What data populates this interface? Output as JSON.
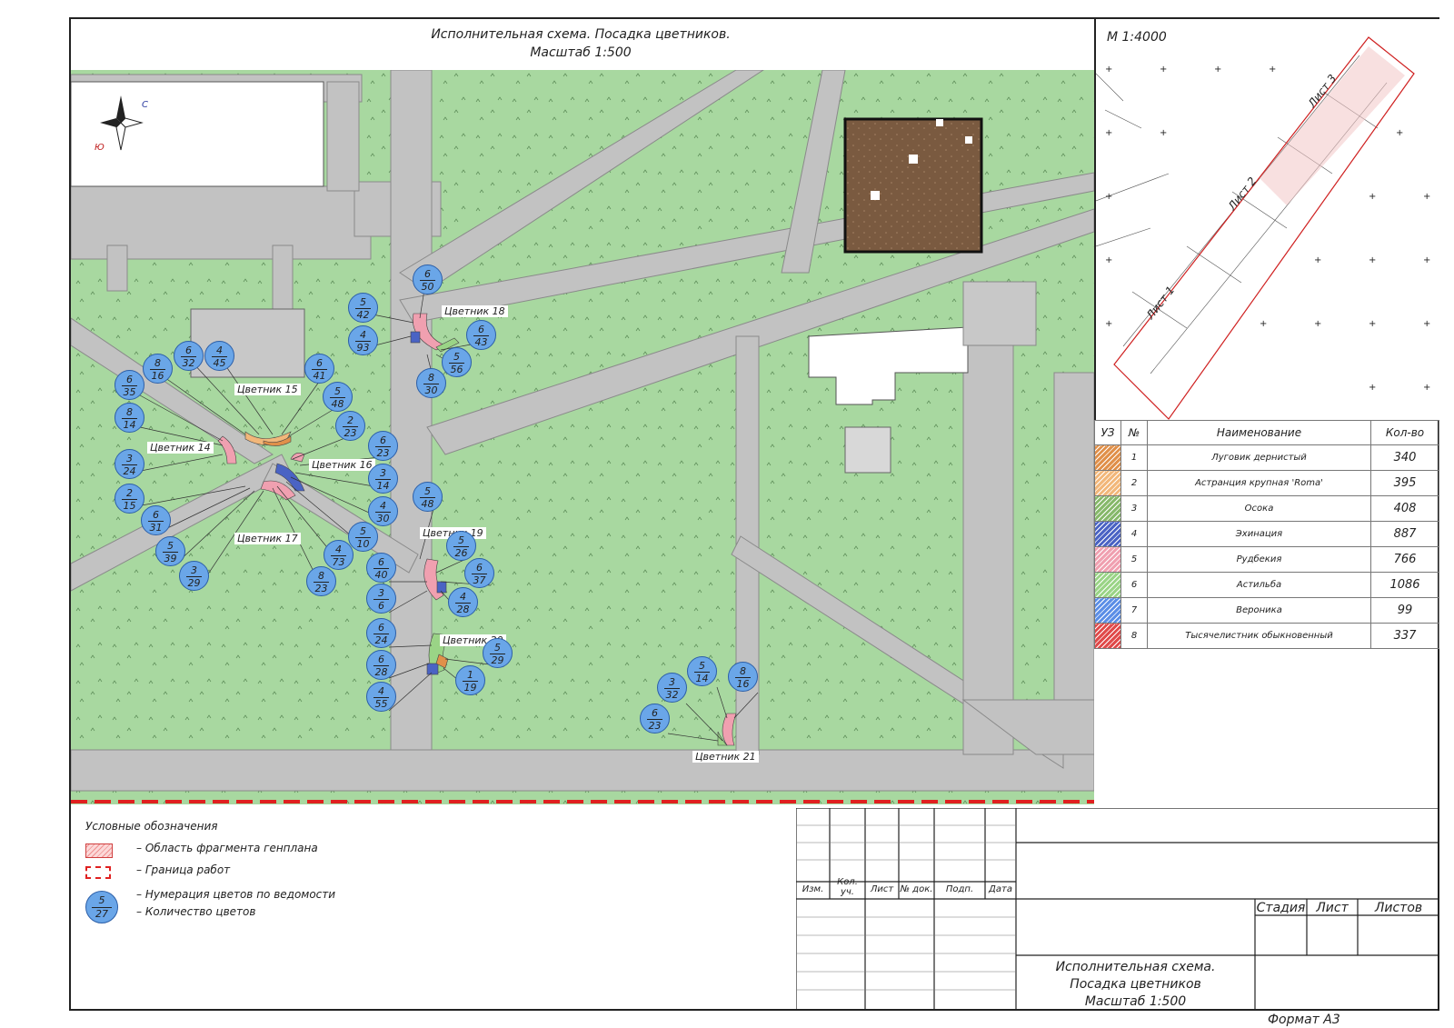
{
  "title": {
    "line1": "Исполнительная схема. Посадка цветников.",
    "line2": "Масштаб 1:500"
  },
  "inset": {
    "scale": "М 1:4000",
    "sheet1": "Лист 1",
    "sheet2": "Лист 2",
    "sheet3": "Лист 3"
  },
  "compass": {
    "north": "С",
    "south": "Ю"
  },
  "plant_table": {
    "headers": [
      "УЗ",
      "№",
      "Наименование",
      "Кол-во"
    ],
    "rows": [
      {
        "num": "1",
        "name": "Луговик дернистый",
        "qty": "340",
        "color": "#e0904a"
      },
      {
        "num": "2",
        "name": "Астранция крупная 'Roma'",
        "qty": "395",
        "color": "#f2b77a"
      },
      {
        "num": "3",
        "name": "Осока",
        "qty": "408",
        "color": "#86b86a"
      },
      {
        "num": "4",
        "name": "Эхинация",
        "qty": "887",
        "color": "#4a63c4"
      },
      {
        "num": "5",
        "name": "Рудбекия",
        "qty": "766",
        "color": "#f0a0b0"
      },
      {
        "num": "6",
        "name": "Астильба",
        "qty": "1086",
        "color": "#9ad486"
      },
      {
        "num": "7",
        "name": "Вероника",
        "qty": "99",
        "color": "#5b8ee6"
      },
      {
        "num": "8",
        "name": "Тысячелистник обыкновенный",
        "qty": "337",
        "color": "#e04a4a"
      }
    ]
  },
  "flowerbeds": [
    "Цветник 18",
    "Цветник 15",
    "Цветник 14",
    "Цветник 16",
    "Цветник 19",
    "Цветник 17",
    "Цветник 20",
    "Цветник 21"
  ],
  "markers": [
    {
      "n": "6",
      "q": "50"
    },
    {
      "n": "5",
      "q": "42"
    },
    {
      "n": "4",
      "q": "93"
    },
    {
      "n": "6",
      "q": "43"
    },
    {
      "n": "5",
      "q": "56"
    },
    {
      "n": "8",
      "q": "30"
    },
    {
      "n": "8",
      "q": "16"
    },
    {
      "n": "6",
      "q": "32"
    },
    {
      "n": "4",
      "q": "45"
    },
    {
      "n": "6",
      "q": "41"
    },
    {
      "n": "5",
      "q": "48"
    },
    {
      "n": "6",
      "q": "35"
    },
    {
      "n": "8",
      "q": "14"
    },
    {
      "n": "3",
      "q": "24"
    },
    {
      "n": "2",
      "q": "15"
    },
    {
      "n": "6",
      "q": "31"
    },
    {
      "n": "5",
      "q": "39"
    },
    {
      "n": "3",
      "q": "29"
    },
    {
      "n": "2",
      "q": "23"
    },
    {
      "n": "6",
      "q": "23"
    },
    {
      "n": "3",
      "q": "14"
    },
    {
      "n": "4",
      "q": "30"
    },
    {
      "n": "5",
      "q": "10"
    },
    {
      "n": "4",
      "q": "73"
    },
    {
      "n": "8",
      "q": "23"
    },
    {
      "n": "5",
      "q": "48"
    },
    {
      "n": "5",
      "q": "26"
    },
    {
      "n": "6",
      "q": "37"
    },
    {
      "n": "6",
      "q": "40"
    },
    {
      "n": "3",
      "q": "6"
    },
    {
      "n": "4",
      "q": "28"
    },
    {
      "n": "6",
      "q": "24"
    },
    {
      "n": "6",
      "q": "28"
    },
    {
      "n": "4",
      "q": "55"
    },
    {
      "n": "5",
      "q": "29"
    },
    {
      "n": "1",
      "q": "19"
    },
    {
      "n": "3",
      "q": "32"
    },
    {
      "n": "5",
      "q": "14"
    },
    {
      "n": "8",
      "q": "16"
    },
    {
      "n": "6",
      "q": "23"
    }
  ],
  "legend": {
    "title": "Условные обозначения",
    "item1": "– Область фрагмента генплана",
    "item2": "– Граница работ",
    "item3": "– Нумерация цветов по ведомости",
    "item4": "– Количество цветов",
    "sample_n": "5",
    "sample_q": "27"
  },
  "stamp": {
    "izm": "Изм.",
    "kol": "Кол. уч.",
    "list": "Лист",
    "ndok": "№ док.",
    "podp": "Подп.",
    "data": "Дата",
    "stadia": "Стадия",
    "list2": "Лист",
    "listov": "Листов",
    "name1": "Исполнительная схема.",
    "name2": "Посадка цветников",
    "name3": "Масштаб 1:500",
    "format": "Формат А3"
  },
  "colors": {
    "grass": "#a8d8a0",
    "road": "#c2c2c2",
    "building": "#ffffff",
    "site": "#7a5a40",
    "marker": "#6aa6e8",
    "boundary": "#e02020"
  }
}
